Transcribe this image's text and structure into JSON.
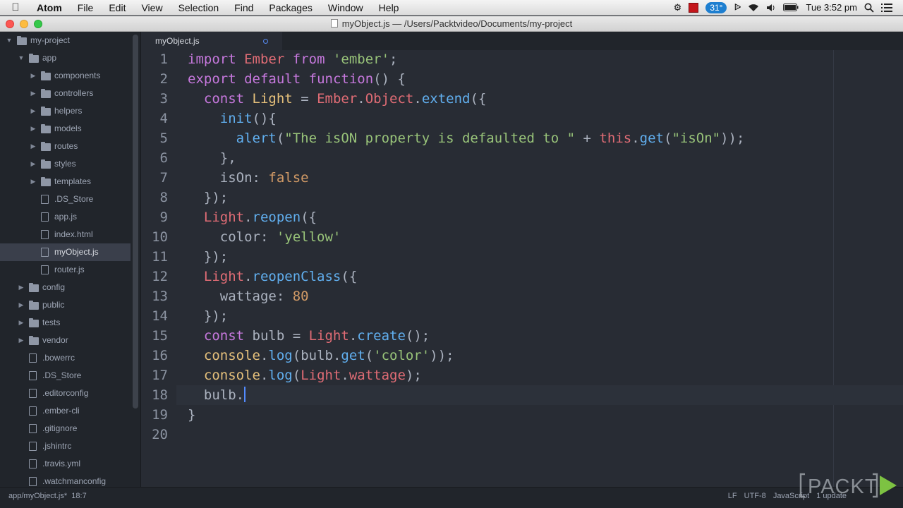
{
  "menubar": {
    "apple_icon": "apple-icon",
    "app_name": "Atom",
    "menus": [
      "File",
      "Edit",
      "View",
      "Selection",
      "Find",
      "Packages",
      "Window",
      "Help"
    ],
    "temperature": "31°",
    "clock": "Tue 3:52 pm"
  },
  "window": {
    "title": "myObject.js — /Users/Packtvideo/Documents/my-project"
  },
  "tree": {
    "rows": [
      {
        "label": "my-project",
        "type": "folder",
        "depth": 0,
        "expanded": true
      },
      {
        "label": "app",
        "type": "folder",
        "depth": 1,
        "expanded": true
      },
      {
        "label": "components",
        "type": "folder",
        "depth": 2,
        "expanded": false
      },
      {
        "label": "controllers",
        "type": "folder",
        "depth": 2,
        "expanded": false
      },
      {
        "label": "helpers",
        "type": "folder",
        "depth": 2,
        "expanded": false
      },
      {
        "label": "models",
        "type": "folder",
        "depth": 2,
        "expanded": false
      },
      {
        "label": "routes",
        "type": "folder",
        "depth": 2,
        "expanded": false
      },
      {
        "label": "styles",
        "type": "folder",
        "depth": 2,
        "expanded": false
      },
      {
        "label": "templates",
        "type": "folder",
        "depth": 2,
        "expanded": false
      },
      {
        "label": ".DS_Store",
        "type": "file",
        "depth": 2
      },
      {
        "label": "app.js",
        "type": "file",
        "depth": 2
      },
      {
        "label": "index.html",
        "type": "file",
        "depth": 2
      },
      {
        "label": "myObject.js",
        "type": "file",
        "depth": 2,
        "selected": true
      },
      {
        "label": "router.js",
        "type": "file",
        "depth": 2
      },
      {
        "label": "config",
        "type": "folder",
        "depth": 1,
        "expanded": false
      },
      {
        "label": "public",
        "type": "folder",
        "depth": 1,
        "expanded": false
      },
      {
        "label": "tests",
        "type": "folder",
        "depth": 1,
        "expanded": false
      },
      {
        "label": "vendor",
        "type": "folder",
        "depth": 1,
        "expanded": false
      },
      {
        "label": ".bowerrc",
        "type": "file",
        "depth": 1
      },
      {
        "label": ".DS_Store",
        "type": "file",
        "depth": 1
      },
      {
        "label": ".editorconfig",
        "type": "file",
        "depth": 1
      },
      {
        "label": ".ember-cli",
        "type": "file",
        "depth": 1
      },
      {
        "label": ".gitignore",
        "type": "file",
        "depth": 1
      },
      {
        "label": ".jshintrc",
        "type": "file",
        "depth": 1
      },
      {
        "label": ".travis.yml",
        "type": "file",
        "depth": 1
      },
      {
        "label": ".watchmanconfig",
        "type": "file",
        "depth": 1
      }
    ]
  },
  "tab": {
    "label": "myObject.js"
  },
  "editor": {
    "cursor_line": 18,
    "lines": [
      [
        [
          "kw",
          "import"
        ],
        [
          "pl",
          " "
        ],
        [
          "var",
          "Ember"
        ],
        [
          "pl",
          " "
        ],
        [
          "kw",
          "from"
        ],
        [
          "pl",
          " "
        ],
        [
          "str",
          "'ember'"
        ],
        [
          "pl",
          ";"
        ]
      ],
      [
        [
          "kw",
          "export"
        ],
        [
          "pl",
          " "
        ],
        [
          "kw",
          "default"
        ],
        [
          "pl",
          " "
        ],
        [
          "kw",
          "function"
        ],
        [
          "pl",
          "() {"
        ]
      ],
      [
        [
          "pl",
          "  "
        ],
        [
          "kw",
          "const"
        ],
        [
          "pl",
          " "
        ],
        [
          "cls",
          "Light"
        ],
        [
          "pl",
          " = "
        ],
        [
          "var",
          "Ember"
        ],
        [
          "pl",
          "."
        ],
        [
          "var",
          "Object"
        ],
        [
          "pl",
          "."
        ],
        [
          "fn",
          "extend"
        ],
        [
          "pl",
          "({"
        ]
      ],
      [
        [
          "pl",
          "    "
        ],
        [
          "fn",
          "init"
        ],
        [
          "pl",
          "(){"
        ]
      ],
      [
        [
          "pl",
          "      "
        ],
        [
          "fn",
          "alert"
        ],
        [
          "pl",
          "("
        ],
        [
          "str",
          "\"The isON property is defaulted to \""
        ],
        [
          "pl",
          " + "
        ],
        [
          "var",
          "this"
        ],
        [
          "pl",
          "."
        ],
        [
          "fn",
          "get"
        ],
        [
          "pl",
          "("
        ],
        [
          "str",
          "\"isOn\""
        ],
        [
          "pl",
          "));"
        ]
      ],
      [
        [
          "pl",
          "    },"
        ]
      ],
      [
        [
          "pl",
          "    isOn: "
        ],
        [
          "num",
          "false"
        ]
      ],
      [
        [
          "pl",
          "  });"
        ]
      ],
      [
        [
          "pl",
          "  "
        ],
        [
          "var",
          "Light"
        ],
        [
          "pl",
          "."
        ],
        [
          "fn",
          "reopen"
        ],
        [
          "pl",
          "({"
        ]
      ],
      [
        [
          "pl",
          "    color: "
        ],
        [
          "str",
          "'yellow'"
        ]
      ],
      [
        [
          "pl",
          "  });"
        ]
      ],
      [
        [
          "pl",
          "  "
        ],
        [
          "var",
          "Light"
        ],
        [
          "pl",
          "."
        ],
        [
          "fn",
          "reopenClass"
        ],
        [
          "pl",
          "({"
        ]
      ],
      [
        [
          "pl",
          "    wattage: "
        ],
        [
          "num",
          "80"
        ]
      ],
      [
        [
          "pl",
          "  });"
        ]
      ],
      [
        [
          "pl",
          "  "
        ],
        [
          "kw",
          "const"
        ],
        [
          "pl",
          " bulb = "
        ],
        [
          "var",
          "Light"
        ],
        [
          "pl",
          "."
        ],
        [
          "fn",
          "create"
        ],
        [
          "pl",
          "();"
        ]
      ],
      [
        [
          "pl",
          "  "
        ],
        [
          "cls",
          "console"
        ],
        [
          "pl",
          "."
        ],
        [
          "fn",
          "log"
        ],
        [
          "pl",
          "(bulb."
        ],
        [
          "fn",
          "get"
        ],
        [
          "pl",
          "("
        ],
        [
          "str",
          "'color'"
        ],
        [
          "pl",
          "));"
        ]
      ],
      [
        [
          "pl",
          "  "
        ],
        [
          "cls",
          "console"
        ],
        [
          "pl",
          "."
        ],
        [
          "fn",
          "log"
        ],
        [
          "pl",
          "("
        ],
        [
          "var",
          "Light"
        ],
        [
          "pl",
          "."
        ],
        [
          "var",
          "wattage"
        ],
        [
          "pl",
          ");"
        ]
      ],
      [
        [
          "pl",
          "  bulb."
        ]
      ],
      [
        [
          "pl",
          "}"
        ]
      ],
      [
        [
          "pl",
          ""
        ]
      ]
    ]
  },
  "status": {
    "path": "app/myObject.js*",
    "position": "18:7",
    "line_ending": "LF",
    "encoding": "UTF-8",
    "grammar": "JavaScript",
    "update": "1 update"
  },
  "watermark": {
    "text": "PACKT"
  }
}
